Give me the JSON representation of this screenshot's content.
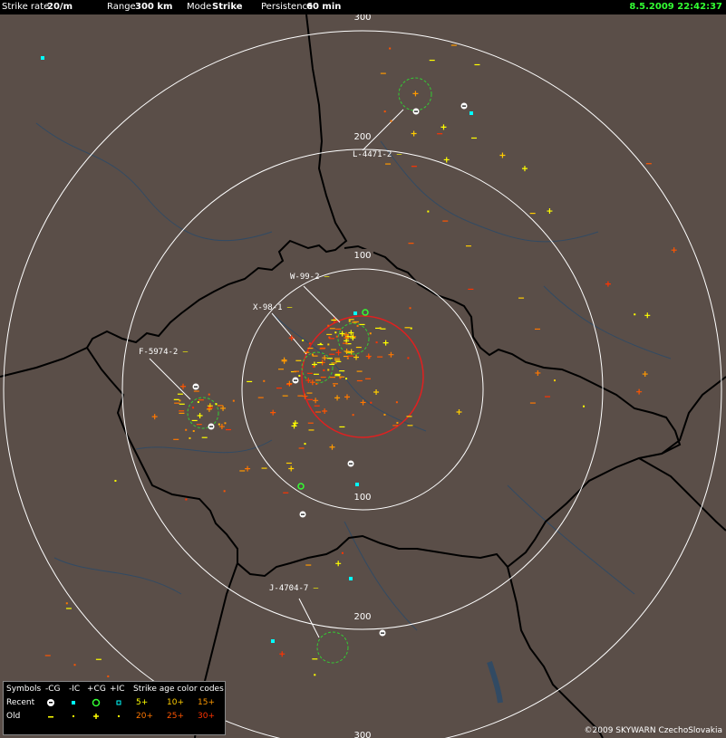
{
  "header": {
    "strike_rate_label": "Strike rate",
    "strike_rate_value": "20/m",
    "range_label": "Range",
    "range_value": "300 km",
    "mode_label": "Mode",
    "mode_value": "Strike",
    "persistence_label": "Persistence",
    "persistence_value": "60 min",
    "timestamp": "8.5.2009 22:42:37",
    "timestamp_color": "#33ff33"
  },
  "range_rings": {
    "labels": [
      "100",
      "200",
      "300"
    ],
    "color": "#ffffff"
  },
  "cells": [
    {
      "id": "L-4471-2",
      "label": "L-4471-2"
    },
    {
      "id": "W-99-2",
      "label": "W-99-2"
    },
    {
      "id": "X-98-1",
      "label": "X-98-1"
    },
    {
      "id": "F-5974-2",
      "label": "F-5974-2"
    },
    {
      "id": "J-4704-7",
      "label": "J-4704-7"
    }
  ],
  "legend": {
    "symbols_label": "Symbols",
    "cols": [
      "-CG",
      "-IC",
      "+CG",
      "+IC"
    ],
    "age_title": "Strike age color codes",
    "row_recent": "Recent",
    "row_old": "Old",
    "ages_row1": [
      "5+",
      "10+",
      "15+"
    ],
    "ages_row2": [
      "20+",
      "25+",
      "30+"
    ],
    "age_colors": [
      "#ffff00",
      "#ffcc00",
      "#ff9900",
      "#ff7700",
      "#ff5500",
      "#ff3300"
    ]
  },
  "credit": "©2009 SKYWARN CzechoSlovakia",
  "colors": {
    "map_bg": "#5a4e48",
    "border": "#000000",
    "water": "#2a4a6a",
    "storm_red": "#e02020",
    "cell_green": "#33cc33"
  }
}
